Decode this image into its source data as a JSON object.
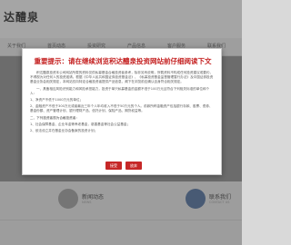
{
  "site": {
    "logo": "达醴泉",
    "nav": [
      "关于我们",
      "首页动态",
      "投资研究",
      "产品信息",
      "客户服务",
      "联系我们"
    ],
    "tiles": [
      {
        "title": "新闻动态",
        "subtitle": "NEWS"
      },
      {
        "title": "联系我们",
        "subtitle": "CONTACT US"
      }
    ]
  },
  "modal": {
    "title": "重要提示：请在继续浏览积达醴泉投资网站前仔细阅读下文",
    "paragraphs": [
      {
        "kind": "body",
        "text": "积达醴泉投资本公司网站所载的资料仅供私募基金合格投资者参考，除非另有说明，所载资料不构成任何投资建议或要约，不得视为对任何人的投资邀请。根据《中华人民共和国证券投资基金法》、《私募投资基金监督管理暂行办法》及中国证券投资基金业协会相关规定，本网站仅向特定合格投资者提供产品信息，阁下在浏览前应确认自身符合相关规定。"
      },
      {
        "kind": "body",
        "text": "一、具备相应风险识别能力和风险承担能力，投资于单只私募基金的金额不低于100万元且符合下列相关标准的单位和个人："
      },
      {
        "kind": "item",
        "text": "1、净资产不低于1000万元的单位；"
      },
      {
        "kind": "item",
        "text": "2、金融资产不低于300万元或者最近三年个人年均收入不低于50万元的个人。前款所称金融资产包括银行存款、股票、债券、基金份额、资产管理计划、银行理财产品、信托计划、保险产品、期货权益等。"
      },
      {
        "kind": "heading",
        "text": "二、下列投资者视为合格投资者："
      },
      {
        "kind": "item",
        "text": "1、社会保障基金、企业年金等养老基金，慈善基金等社会公益基金；"
      },
      {
        "kind": "item",
        "text": "2、依法设立并在基金业协会备案的投资计划；"
      }
    ],
    "accept_label": "接受",
    "decline_label": "放弃"
  }
}
